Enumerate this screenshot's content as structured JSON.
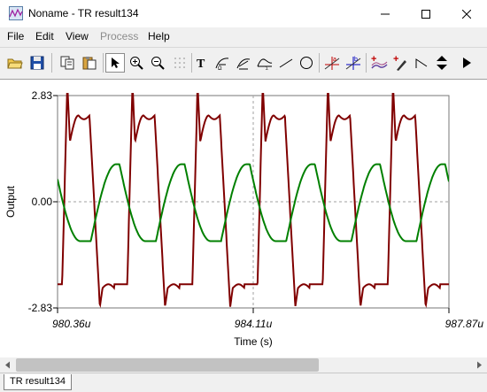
{
  "window": {
    "title": "Noname - TR result134",
    "minimize_icon": "minimize-icon",
    "maximize_icon": "maximize-icon",
    "close_icon": "close-icon"
  },
  "menu": {
    "items": [
      "File",
      "Edit",
      "View",
      "Process",
      "Help"
    ]
  },
  "toolbar": {
    "icons": [
      "open-folder-icon",
      "save-icon",
      "copy-icon",
      "paste-icon",
      "pointer-icon",
      "zoom-in-icon",
      "zoom-out-icon",
      "grid-icon",
      "text-icon",
      "curve-annotation-icon",
      "curve-annotation-2-icon",
      "curve-annotation-3-icon",
      "line-icon",
      "ellipse-icon",
      "cursor-a-icon",
      "cursor-b-icon",
      "add-trace-icon",
      "add-probe-icon",
      "step-icon",
      "arrow-up-down-icon",
      "arrow-right-icon"
    ]
  },
  "plot": {
    "y_top_label": "2.83",
    "y_mid_label": "0.00",
    "y_bottom_label": "-2.83",
    "x_left_label": "980.36u",
    "x_mid_label": "984.11u",
    "x_right_label": "987.87u",
    "ylabel": "Output",
    "xlabel": "Time (s)"
  },
  "chart_data": {
    "type": "line",
    "xlabel": "Time (s)",
    "ylabel": "Output",
    "xlim": [
      980.36,
      987.87
    ],
    "x_unit": "u",
    "ylim": [
      -2.83,
      2.83
    ],
    "grid": true,
    "series": [
      {
        "color": "#800000",
        "period": 1.25,
        "x_start": 980.36,
        "peak": 2.3,
        "spike_max": 2.83,
        "trough": -2.2
      },
      {
        "color": "#008000",
        "period": 1.25,
        "x_start": 980.36,
        "peak": 1.0,
        "trough": -1.05
      }
    ]
  },
  "status": {
    "tab_label": "TR result134"
  }
}
